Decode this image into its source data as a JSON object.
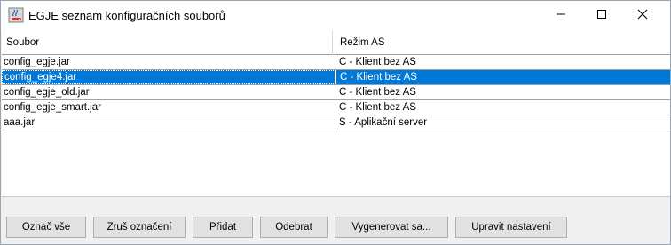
{
  "window": {
    "title": "EGJE seznam konfiguračních souborů"
  },
  "icons": {
    "app": "java-coffee-icon",
    "minimize": "minimize-icon",
    "maximize": "maximize-icon",
    "close": "close-icon"
  },
  "table": {
    "columns": [
      "Soubor",
      "Režim AS"
    ],
    "rows": [
      {
        "soubor": "config_egje.jar",
        "rezim": "C - Klient bez AS",
        "selected": false
      },
      {
        "soubor": "config_egje4.jar",
        "rezim": "C - Klient bez AS",
        "selected": true
      },
      {
        "soubor": "config_egje_old.jar",
        "rezim": "C - Klient bez AS",
        "selected": false
      },
      {
        "soubor": "config_egje_smart.jar",
        "rezim": "C - Klient bez AS",
        "selected": false
      },
      {
        "soubor": "aaa.jar",
        "rezim": "S - Aplikační server",
        "selected": false
      }
    ]
  },
  "buttons": {
    "select_all": "Označ vše",
    "deselect": "Zruš označení",
    "add": "Přidat",
    "remove": "Odebrat",
    "generate": "Vygenerovat sa...",
    "edit_settings": "Upravit nastavení"
  },
  "colors": {
    "selection": "#0078d7",
    "titlebar": "#ffffff",
    "window_bg": "#f0f0f0"
  }
}
